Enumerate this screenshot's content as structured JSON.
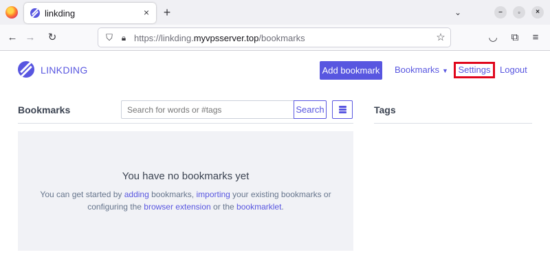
{
  "browser": {
    "tab_title": "linkding",
    "tab_close": "×",
    "new_tab": "+",
    "url_prefix": "https://linkding.",
    "url_domain": "myvpsserver.top",
    "url_path": "/bookmarks",
    "icons": [
      "firefox-icon",
      "back-icon",
      "forward-icon",
      "reload-icon",
      "shield-icon",
      "lock-icon",
      "star-icon",
      "pocket-icon",
      "extensions-icon",
      "menu-icon"
    ]
  },
  "app": {
    "brand": "LINKDING",
    "brand_color": "#5856e0",
    "nav": {
      "add_bookmark": "Add bookmark",
      "bookmarks": "Bookmarks",
      "settings": "Settings",
      "logout": "Logout"
    },
    "highlight_color": "#e0061c"
  },
  "bookmarks": {
    "title": "Bookmarks",
    "search_placeholder": "Search for words or #tags",
    "search_button": "Search"
  },
  "tags": {
    "title": "Tags"
  },
  "empty": {
    "title": "You have no bookmarks yet",
    "l1_a": "You can get started by ",
    "l1_link1": "adding",
    "l1_b": " bookmarks, ",
    "l1_link2": "importing",
    "l1_c": " your existing bookmarks or",
    "l2_a": "configuring the ",
    "l2_link1": "browser extension",
    "l2_b": " or the ",
    "l2_link2": "bookmarklet",
    "l2_c": "."
  }
}
